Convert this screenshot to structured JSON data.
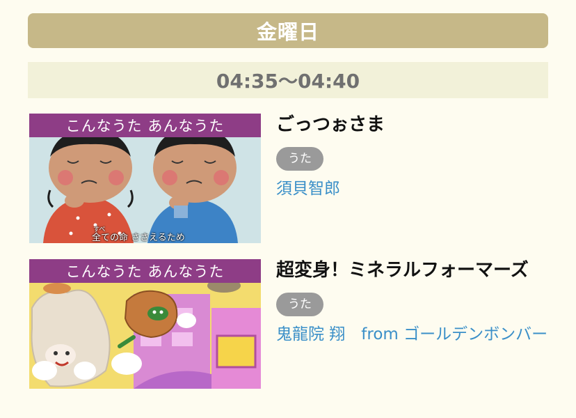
{
  "day": "金曜日",
  "time_slot": "04:35〜04:40",
  "programs": [
    {
      "series": "こんなうた あんなうた",
      "title": "ごっつぉさま",
      "tag": "うた",
      "performer": "須貝智郎",
      "caption_ruby": "すべ",
      "caption": "全ての命 ささえるため"
    },
    {
      "series": "こんなうた あんなうた",
      "title": "超変身！ミネラルフォーマーズ",
      "tag": "うた",
      "performer": "鬼龍院 翔　from ゴールデンボンバー"
    }
  ],
  "colors": {
    "day_header_bg": "#c6b888",
    "time_band_bg": "#f2f1d9",
    "banner": "#8e3d86",
    "tag_bg": "#9a9a9a",
    "link": "#3a8fc8"
  }
}
